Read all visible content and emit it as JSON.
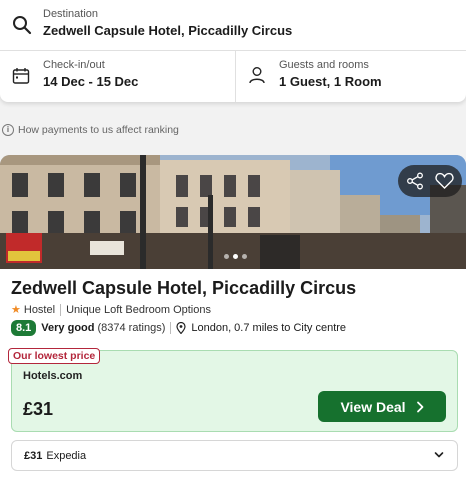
{
  "search": {
    "destination_label": "Destination",
    "destination_value": "Zedwell Capsule Hotel, Piccadilly Circus",
    "checkin_label": "Check-in/out",
    "checkin_value": "14 Dec - 15 Dec",
    "guests_label": "Guests and rooms",
    "guests_value": "1 Guest, 1 Room"
  },
  "ranking_note": "How payments to us affect ranking",
  "hotel": {
    "name": "Zedwell Capsule Hotel, Piccadilly Circus",
    "type": "Hostel",
    "room_type": "Unique Loft Bedroom Options",
    "score": "8.1",
    "rating_word": "Very good",
    "rating_count": "(8374 ratings)",
    "location": "London, 0.7 miles to City centre",
    "photo_count_dots": 3,
    "photo_active_index": 1
  },
  "deal": {
    "tag": "Our lowest price",
    "provider": "Hotels.com",
    "price": "£31",
    "button_label": "View Deal"
  },
  "alternate": {
    "price": "£31",
    "provider": "Expedia"
  },
  "colors": {
    "score_bg": "#1d7a36",
    "deal_bg": "#e3f7e6",
    "button_bg": "#16712e",
    "tag_color": "#b3263b",
    "star": "#f08a24"
  }
}
